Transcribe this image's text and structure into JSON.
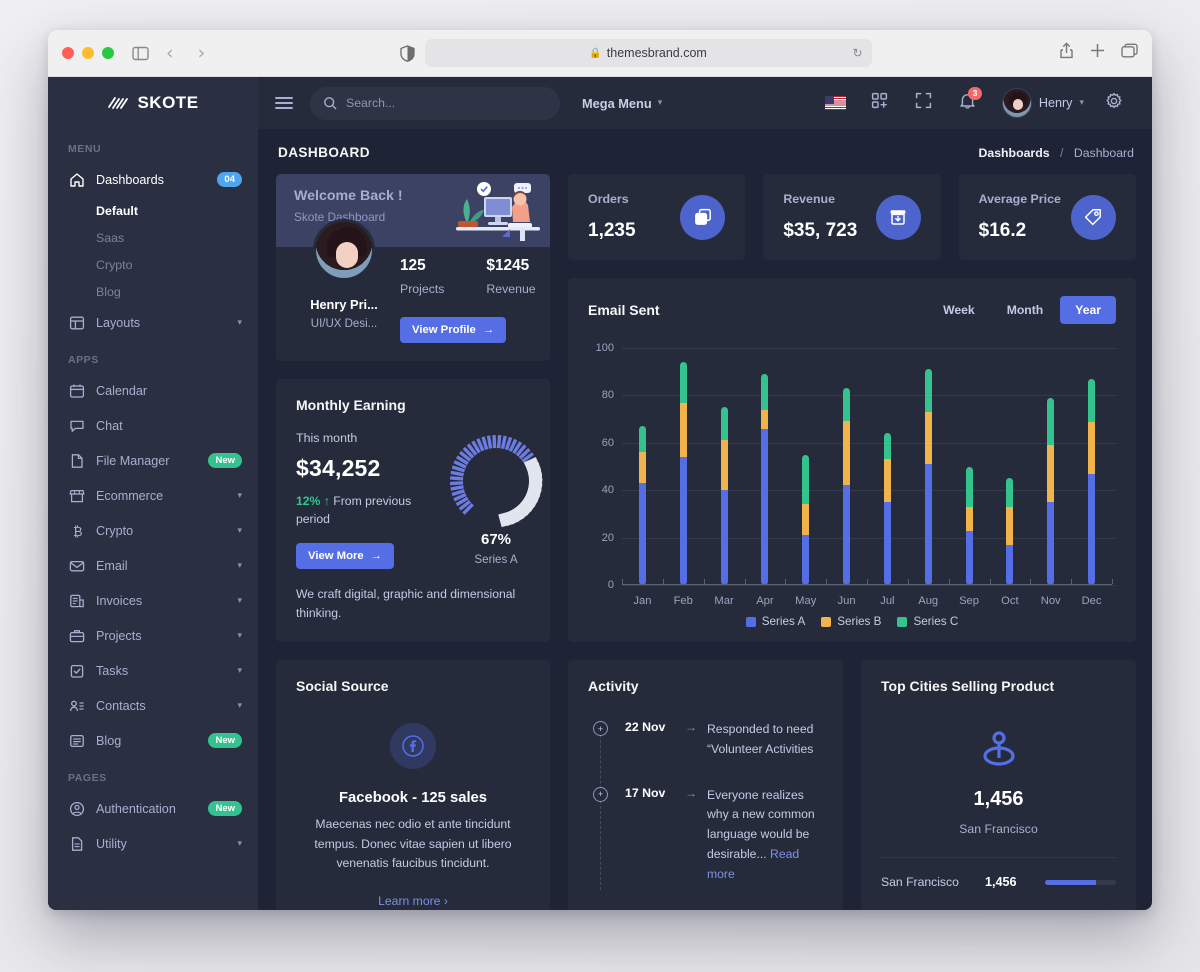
{
  "browser": {
    "url": "themesbrand.com",
    "lock_icon": "lock-icon",
    "reload_icon": "reload-icon",
    "shield_icon": "shield-icon",
    "sidebar_toggle_icon": "sidebar-toggle-icon",
    "back_icon": "chevron-left-icon",
    "forward_icon": "chevron-right-icon",
    "share_icon": "share-icon",
    "newtab_icon": "plus-icon",
    "tabs_icon": "tabs-icon"
  },
  "sidebar": {
    "brand": "SKOTE",
    "sections": [
      {
        "label": "MENU"
      },
      {
        "label": "APPS"
      },
      {
        "label": "PAGES"
      }
    ],
    "menu_items": [
      {
        "label": "Dashboards",
        "icon": "home-icon",
        "badge": "04",
        "badge_type": "info",
        "active": true
      },
      {
        "label": "Layouts",
        "icon": "layout-icon",
        "chevron": "chevron-down-icon"
      }
    ],
    "dashboard_subitems": [
      {
        "label": "Default",
        "active": true
      },
      {
        "label": "Saas",
        "active": false
      },
      {
        "label": "Crypto",
        "active": false
      },
      {
        "label": "Blog",
        "active": false
      }
    ],
    "apps_items": [
      {
        "label": "Calendar",
        "icon": "calendar-icon"
      },
      {
        "label": "Chat",
        "icon": "chat-icon"
      },
      {
        "label": "File Manager",
        "icon": "file-icon",
        "badge": "New",
        "badge_type": "success"
      },
      {
        "label": "Ecommerce",
        "icon": "store-icon",
        "chevron": "chevron-down-icon"
      },
      {
        "label": "Crypto",
        "icon": "bitcoin-icon",
        "chevron": "chevron-down-icon"
      },
      {
        "label": "Email",
        "icon": "mail-icon",
        "chevron": "chevron-down-icon"
      },
      {
        "label": "Invoices",
        "icon": "invoice-icon",
        "chevron": "chevron-down-icon"
      },
      {
        "label": "Projects",
        "icon": "briefcase-icon",
        "chevron": "chevron-down-icon"
      },
      {
        "label": "Tasks",
        "icon": "clipboard-check-icon",
        "chevron": "chevron-down-icon"
      },
      {
        "label": "Contacts",
        "icon": "contacts-icon",
        "chevron": "chevron-down-icon"
      },
      {
        "label": "Blog",
        "icon": "blog-icon",
        "badge": "New",
        "badge_type": "success"
      }
    ],
    "pages_items": [
      {
        "label": "Authentication",
        "icon": "user-circle-icon",
        "badge": "New",
        "badge_type": "success"
      },
      {
        "label": "Utility",
        "icon": "doc-icon",
        "chevron": "chevron-down-icon"
      }
    ]
  },
  "topbar": {
    "menu_toggle_icon": "hamburger-icon",
    "search_placeholder": "Search...",
    "search_value": "",
    "search_icon": "search-icon",
    "mega_menu": "Mega Menu",
    "mega_menu_chevron": "chevron-down-icon",
    "flag_icon": "us-flag-icon",
    "apps_icon": "grid-apps-icon",
    "fullscreen_icon": "fullscreen-icon",
    "bell_icon": "bell-icon",
    "notification_count": "3",
    "user_name": "Henry",
    "user_chevron": "chevron-down-icon",
    "settings_icon": "gear-icon",
    "avatar_icon": "avatar"
  },
  "page": {
    "title": "DASHBOARD",
    "breadcrumb_parent": "Dashboards",
    "breadcrumb_sep": "/",
    "breadcrumb_current": "Dashboard"
  },
  "welcome": {
    "heading": "Welcome Back !",
    "subheading": "Skote Dashboard",
    "user_name": "Henry Pri...",
    "user_role": "UI/UX Desi...",
    "projects_value": "125",
    "projects_label": "Projects",
    "revenue_value": "$1245",
    "revenue_label": "Revenue",
    "button": "View Profile",
    "button_arrow": "arrow-right-icon"
  },
  "stats": [
    {
      "title": "Orders",
      "value": "1,235",
      "icon": "copy-icon"
    },
    {
      "title": "Revenue",
      "value": "$35, 723",
      "icon": "archive-down-icon"
    },
    {
      "title": "Average Price",
      "value": "$16.2",
      "icon": "tag-icon"
    }
  ],
  "monthly_earning": {
    "title": "Monthly Earning",
    "subtitle": "This month",
    "amount": "$34,252",
    "delta": "12%",
    "delta_arrow": "arrow-up-icon",
    "delta_text": "From previous period",
    "button": "View More",
    "button_arrow": "arrow-right-icon",
    "note": "We craft digital, graphic and dimensional thinking.",
    "gauge_percent": "67%",
    "gauge_series": "Series A",
    "gauge_value": 67
  },
  "email_sent": {
    "title": "Email Sent",
    "ranges": [
      {
        "label": "Week",
        "active": false
      },
      {
        "label": "Month",
        "active": false
      },
      {
        "label": "Year",
        "active": true
      }
    ]
  },
  "chart_data": {
    "type": "bar",
    "title": "Email Sent",
    "stacked": true,
    "xlabel": "",
    "ylabel": "",
    "ylim": [
      0,
      100
    ],
    "yticks": [
      0,
      20,
      40,
      60,
      80,
      100
    ],
    "grid": true,
    "legend_position": "bottom",
    "categories": [
      "Jan",
      "Feb",
      "Mar",
      "Apr",
      "May",
      "Jun",
      "Jul",
      "Aug",
      "Sep",
      "Oct",
      "Nov",
      "Dec"
    ],
    "series": [
      {
        "name": "Series A",
        "color": "#556ee6",
        "values": [
          43,
          54,
          40,
          66,
          21,
          42,
          35,
          51,
          23,
          17,
          35,
          47
        ]
      },
      {
        "name": "Series B",
        "color": "#f1b44c",
        "values": [
          13,
          23,
          21,
          8,
          13,
          27,
          18,
          22,
          10,
          16,
          24,
          22
        ]
      },
      {
        "name": "Series C",
        "color": "#34c38f",
        "values": [
          11,
          17,
          14,
          15,
          21,
          14,
          11,
          18,
          17,
          12,
          20,
          18
        ]
      }
    ],
    "cumulative_tops": {
      "series_a": [
        43,
        54,
        40,
        66,
        21,
        42,
        35,
        51,
        23,
        17,
        35,
        47
      ],
      "series_b": [
        56,
        77,
        61,
        74,
        34,
        69,
        53,
        73,
        33,
        33,
        59,
        69
      ],
      "series_c": [
        67,
        94,
        75,
        89,
        55,
        83,
        64,
        91,
        50,
        45,
        79,
        87
      ]
    }
  },
  "social_source": {
    "title": "Social Source",
    "icon": "facebook-icon",
    "headline": "Facebook - 125 sales",
    "description": "Maecenas nec odio et ante tincidunt tempus. Donec vitae sapien ut libero venenatis faucibus tincidunt.",
    "link": "Learn more",
    "link_arrow": "chevron-right-icon"
  },
  "activity": {
    "title": "Activity",
    "items": [
      {
        "date": "22 Nov",
        "arrow": "arrow-right-icon",
        "text": "Responded to need “Volunteer Activities",
        "link": ""
      },
      {
        "date": "17 Nov",
        "arrow": "arrow-right-icon",
        "text": "Everyone realizes why a new common language would be desirable...",
        "link": "Read more"
      }
    ],
    "dot_icon": "plus-circle-icon"
  },
  "top_cities": {
    "title": "Top Cities Selling Product",
    "icon": "map-pin-icon",
    "value": "1,456",
    "city": "San Francisco",
    "row": {
      "name": "San Francisco",
      "value": "1,456",
      "percent": 72
    }
  },
  "colors": {
    "accent": "#556ee6",
    "success": "#34c38f",
    "warning": "#f1b44c",
    "danger": "#f46a6a",
    "info": "#50a5f1",
    "card_bg": "#262b3c",
    "body_bg": "#1f2336",
    "sidebar_bg": "#2a3042"
  }
}
